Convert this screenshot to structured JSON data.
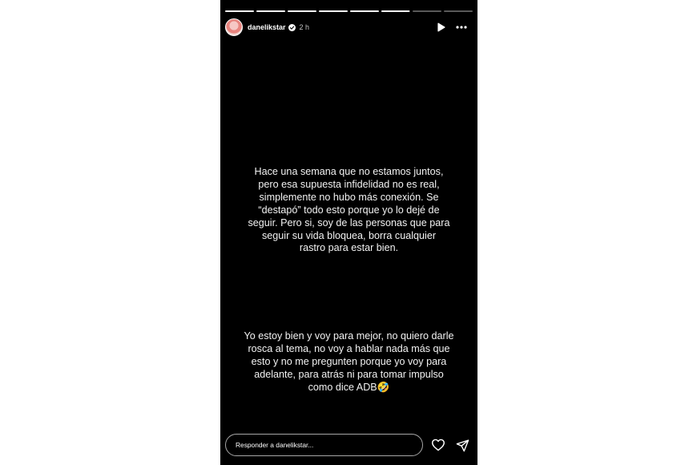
{
  "story": {
    "progress": [
      1,
      1,
      1,
      1,
      1,
      0.98,
      0,
      0
    ],
    "user": {
      "username": "danelikstar",
      "verified": true,
      "time": "2 h",
      "avatar_icon": "avatar-icon"
    },
    "text_1": "Hace una semana que no estamos juntos,\npero esa supuesta infidelidad no es real,\nsimplemente no hubo más conexión. Se\n“destapó” todo esto porque yo lo dejé de\nseguir. Pero si, soy de las personas que para\nseguir su vida bloquea, borra cualquier\nrastro para estar bien.",
    "text_2": "Yo estoy bien y voy para mejor, no quiero darle\nrosca al tema, no voy a hablar nada más que\nesto y no me pregunten porque yo voy para\nadelante, para atrás ni para tomar impulso\ncomo dice ADB🤣",
    "reply_placeholder": "Responder a danelikstar..."
  },
  "icons": {
    "play": "play-icon",
    "more": "more-icon",
    "heart": "heart-icon",
    "send": "send-icon",
    "verified": "verified-badge-icon"
  },
  "colors": {
    "background": "#000000",
    "text": "#f2f2f2",
    "page": "#ffffff"
  }
}
